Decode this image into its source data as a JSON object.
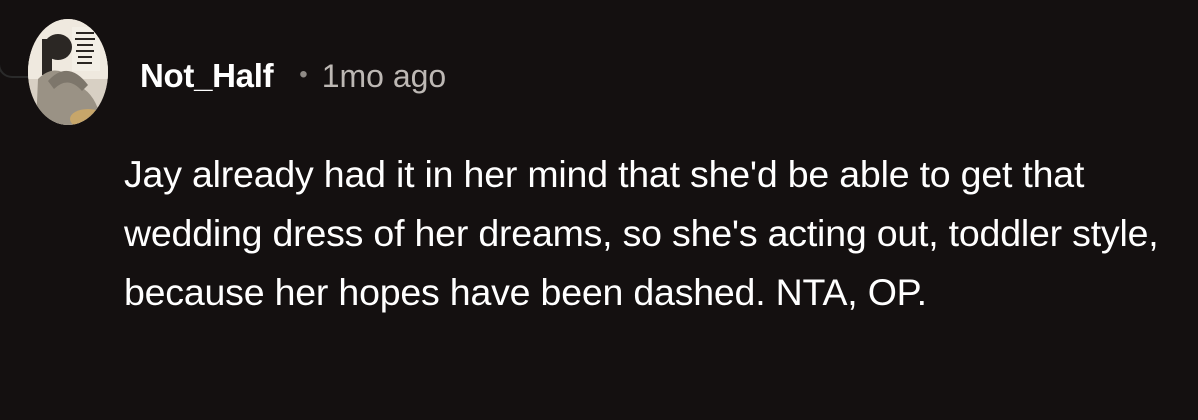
{
  "comment": {
    "author": "Not_Half",
    "separator": "•",
    "timestamp": "1mo ago",
    "text": "Jay already had it in her mind that she'd be able to get that wedding dress of her dreams, so she's acting out, toddler style, because her hopes have been dashed. NTA, OP."
  },
  "avatar": {
    "icon": "user-avatar-photo"
  },
  "colors": {
    "background": "#141010",
    "text": "#ffffff",
    "muted": "#bdb8b4"
  }
}
